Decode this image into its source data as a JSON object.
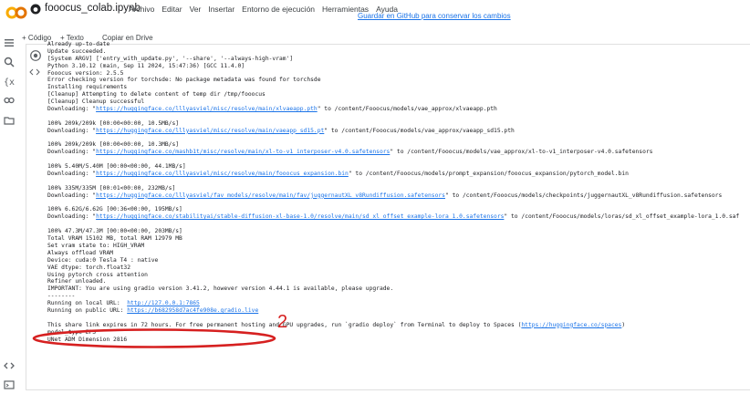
{
  "header": {
    "title": "fooocus_colab.ipynb",
    "menu": [
      "Archivo",
      "Editar",
      "Ver",
      "Insertar",
      "Entorno de ejecución",
      "Herramientas",
      "Ayuda"
    ],
    "github_link": "Guardar en GitHub para conservar los cambios"
  },
  "toolbar": {
    "code": "+ Código",
    "text": "+ Texto",
    "copy": "Copiar en Drive"
  },
  "sidebar": {
    "icons": [
      "menu-icon",
      "search-icon",
      "variables-icon",
      "key-icon",
      "folder-icon",
      "code-snippets-icon",
      "terminal-icon"
    ]
  },
  "colors": {
    "accent": "#1a73e8",
    "annotation": "#d62020",
    "logo_orange": "#f9ab00",
    "logo_orange_dark": "#e37400"
  },
  "annotation": {
    "number": "2"
  },
  "output": [
    {
      "t": "Already up-to-date"
    },
    {
      "t": "Update succeeded."
    },
    {
      "t": "[System ARGV] ['entry_with_update.py', '--share', '--always-high-vram']"
    },
    {
      "t": "Python 3.10.12 (main, Sep 11 2024, 15:47:36) [GCC 11.4.0]"
    },
    {
      "t": "Fooocus version: 2.5.5"
    },
    {
      "t": "Error checking version for torchsde: No package metadata was found for torchsde"
    },
    {
      "t": "Installing requirements"
    },
    {
      "t": "[Cleanup] Attempting to delete content of temp dir /tmp/fooocus"
    },
    {
      "t": "[Cleanup] Cleanup successful"
    },
    {
      "t": "Downloading: \"",
      "link": "https://huggingface.co/lllyasviel/misc/resolve/main/xlvaeapp.pth",
      "after": "\" to /content/Fooocus/models/vae_approx/xlvaeapp.pth"
    },
    {
      "t": ""
    },
    {
      "t": "100% 209k/209k [00:00<00:00, 10.5MB/s]"
    },
    {
      "t": "Downloading: \"",
      "link": "https://huggingface.co/lllyasviel/misc/resolve/main/vaeapp_sd15.pt",
      "after": "\" to /content/Fooocus/models/vae_approx/vaeapp_sd15.pth"
    },
    {
      "t": ""
    },
    {
      "t": "100% 209k/209k [00:00<00:00, 10.3MB/s]"
    },
    {
      "t": "Downloading: \"",
      "link": "https://huggingface.co/mashb1t/misc/resolve/main/xl-to-v1_interposer-v4.0.safetensors",
      "after": "\" to /content/Fooocus/models/vae_approx/xl-to-v1_interposer-v4.0.safetensors"
    },
    {
      "t": ""
    },
    {
      "t": "100% 5.40M/5.40M [00:00<00:00, 44.1MB/s]"
    },
    {
      "t": "Downloading: \"",
      "link": "https://huggingface.co/lllyasviel/misc/resolve/main/fooocus_expansion.bin",
      "after": "\" to /content/Fooocus/models/prompt_expansion/fooocus_expansion/pytorch_model.bin"
    },
    {
      "t": ""
    },
    {
      "t": "100% 335M/335M [00:01<00:00, 232MB/s]"
    },
    {
      "t": "Downloading: \"",
      "link": "https://huggingface.co/lllyasviel/fav_models/resolve/main/fav/juggernautXL_v8Rundiffusion.safetensors",
      "after": "\" to /content/Fooocus/models/checkpoints/juggernautXL_v8Rundiffusion.safetensors"
    },
    {
      "t": ""
    },
    {
      "t": "100% 6.62G/6.62G [00:36<00:00, 195MB/s]"
    },
    {
      "t": "Downloading: \"",
      "link": "https://huggingface.co/stabilityai/stable-diffusion-xl-base-1.0/resolve/main/sd_xl_offset_example-lora_1.0.safetensors",
      "after": "\" to /content/Fooocus/models/loras/sd_xl_offset_example-lora_1.0.saf"
    },
    {
      "t": ""
    },
    {
      "t": "100% 47.3M/47.3M [00:00<00:00, 203MB/s]"
    },
    {
      "t": "Total VRAM 15102 MB, total RAM 12979 MB"
    },
    {
      "t": "Set vram state to: HIGH_VRAM"
    },
    {
      "t": "Always offload VRAM"
    },
    {
      "t": "Device: cuda:0 Tesla T4 : native"
    },
    {
      "t": "VAE dtype: torch.float32"
    },
    {
      "t": "Using pytorch cross attention"
    },
    {
      "t": "Refiner unloaded."
    },
    {
      "t": "IMPORTANT: You are using gradio version 3.41.2, however version 4.44.1 is available, please upgrade."
    },
    {
      "t": "--------"
    },
    {
      "t": "Running on local URL:  ",
      "link": "http://127.0.0.1:7865",
      "after": ""
    },
    {
      "t": "Running on public URL: ",
      "link": "https://b682958d7ac4fe908e.gradio.live",
      "after": ""
    },
    {
      "t": ""
    },
    {
      "t": "This share link expires in 72 hours. For free permanent hosting and GPU upgrades, run `gradio deploy` from Terminal to deploy to Spaces (",
      "link": "https://huggingface.co/spaces",
      "after": ")"
    },
    {
      "t": "model_type EPS"
    },
    {
      "t": "UNet ADM Dimension 2816"
    }
  ]
}
